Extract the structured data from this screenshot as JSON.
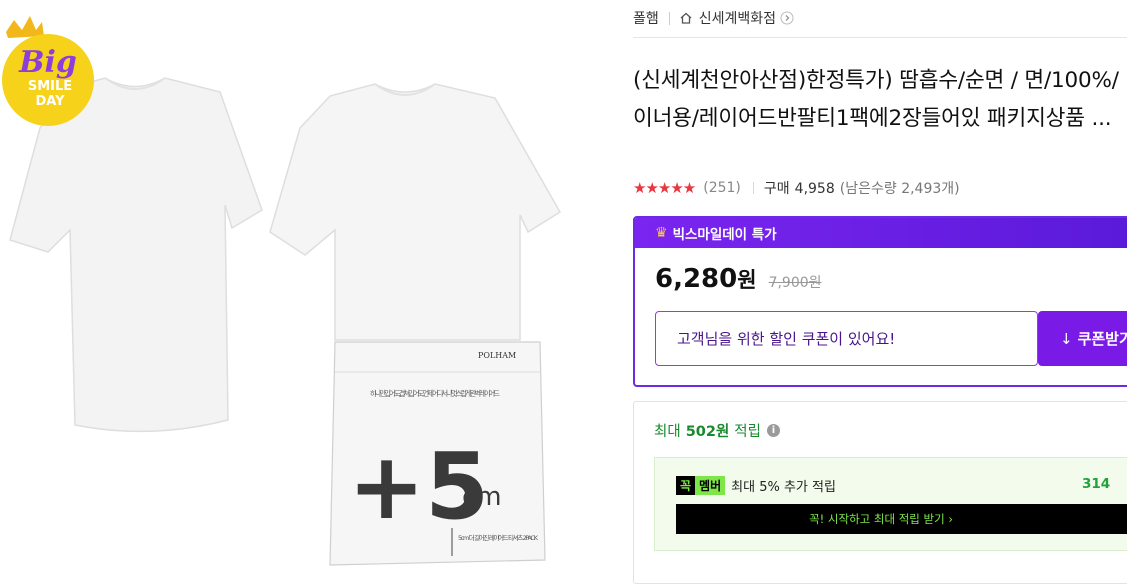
{
  "image": {
    "badge": {
      "line1": "Big",
      "line2": "SMILE",
      "line3": "DAY"
    },
    "pouch": {
      "brand": "POLHAM",
      "note": "하나만 입어도, 겹쳐 입어도, 언제 어디서나 멋스럽게 완벽 레이어드",
      "plus": "+5",
      "unit": "cm",
      "caption": "5cm 더 길어진 레이어드 티셔츠 2PACK"
    }
  },
  "store": {
    "brand": "폴햄",
    "store_name": "신세계백화점"
  },
  "product": {
    "title": "(신세계천안아산점)한정특가) 땀흡수/순면 / 면/100%/이너용/레이어드반팔티1팩에2장들어있 패키지상품 ...",
    "stars": "★★★★★",
    "review_count": "(251)",
    "purchase_label": "구매",
    "purchase_count": "4,958",
    "remaining": "(남은수량 2,493개)"
  },
  "deal": {
    "crown": "♛",
    "label": "빅스마일데이 특가",
    "price": "6,280",
    "price_unit": "원",
    "original_price": "7,900원",
    "coupon_text": "고객님을 위한 할인 쿠폰이 있어요!",
    "coupon_button": "쿠폰받기",
    "coupon_icon": "↓"
  },
  "reward": {
    "prefix": "최대",
    "amount": "502원",
    "suffix": "적립",
    "info_icon": "i",
    "member_logo_a": "꼭",
    "member_logo_b": "멤버",
    "member_text": "최대 5% 추가 적립",
    "member_amount": "314",
    "member_cta": "꼭! 시작하고 최대 적립 받기 ›"
  },
  "colors": {
    "accent": "#7a1ae6",
    "star": "#e8373e",
    "reward": "#1a8a2e"
  }
}
